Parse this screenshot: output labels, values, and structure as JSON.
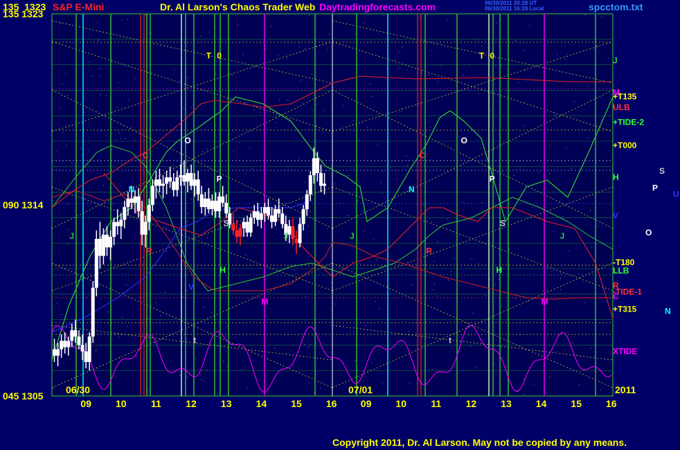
{
  "header": {
    "left_price_a": "135",
    "left_price_b": "1323",
    "symbol": "S&P E-Mini",
    "title": "Dr. Al Larson's Chaos Trader Web",
    "site": "Daytradingforecasts.com",
    "stamp1": "06/30/2011 20:28 UT",
    "stamp2": "06/30/2011 16:28 Local",
    "file": "spcctom.txt"
  },
  "footer": {
    "copyright": "Copyright 2011, Dr. Al Larson. May not be copied by any means."
  },
  "colors": {
    "background": "#000066",
    "grid_green": "#33cc33",
    "yellow": "#ffff00",
    "cyan": "#00ffff",
    "magenta": "#ff00ff",
    "red": "#cc0000",
    "white": "#ffffff",
    "blue": "#3333ff"
  },
  "chart_data": {
    "type": "line",
    "ylim": [
      1305,
      1323
    ],
    "y_ticks": [
      {
        "angle": "045",
        "price": "1305",
        "value": 1305
      },
      {
        "angle": "090",
        "price": "1314",
        "value": 1314
      },
      {
        "angle": "135",
        "price": "1323",
        "value": 1323
      }
    ],
    "x_ticks_day1": [
      "09",
      "10",
      "11",
      "12",
      "13",
      "14",
      "15",
      "16"
    ],
    "x_ticks_day2": [
      "09",
      "10",
      "11",
      "12",
      "13",
      "14",
      "15",
      "16"
    ],
    "date_day1": "06/30",
    "date_day2": "07/01",
    "year": "2011",
    "right_labels": [
      {
        "text": "J",
        "color": "#33cc33",
        "value": 1320.8
      },
      {
        "text": "M",
        "color": "#ff00ff",
        "value": 1319.3
      },
      {
        "text": "+T135",
        "color": "#ffff00",
        "value": 1319.1
      },
      {
        "text": "ULB",
        "color": "#ff3333",
        "value": 1318.6
      },
      {
        "text": "+TIDE-2",
        "color": "#33ff33",
        "value": 1317.9
      },
      {
        "text": "+T000",
        "color": "#ffff00",
        "value": 1316.8
      },
      {
        "text": "H",
        "color": "#33ff33",
        "value": 1315.3
      },
      {
        "text": "V",
        "color": "#3333ff",
        "value": 1313.5
      },
      {
        "text": "-T180",
        "color": "#ffff00",
        "value": 1311.3
      },
      {
        "text": "LLB",
        "color": "#33ff33",
        "value": 1310.9
      },
      {
        "text": "R",
        "color": "#ff3333",
        "value": 1310.2
      },
      {
        "text": "-TIDE-1",
        "color": "#ff3333",
        "value": 1309.9
      },
      {
        "text": "C",
        "color": "#ff00ff",
        "value": 1309.7
      },
      {
        "text": "+T315",
        "color": "#ffff00",
        "value": 1309.1
      },
      {
        "text": "XTIDE",
        "color": "#ff00ff",
        "value": 1307.1
      }
    ],
    "far_right_labels": [
      {
        "text": "S",
        "color": "#cccccc",
        "value": 1315.6
      },
      {
        "text": "P",
        "color": "#ffffff",
        "value": 1314.8
      },
      {
        "text": "U",
        "color": "#3333ff",
        "value": 1314.5
      },
      {
        "text": "O",
        "color": "#ffffff",
        "value": 1312.7
      },
      {
        "text": "N",
        "color": "#00ffff",
        "value": 1309.0
      }
    ],
    "planet_labels_day1": [
      {
        "text": "T",
        "color": "#ffff00",
        "x": 12.5,
        "value": 1320.9
      },
      {
        "text": "0",
        "color": "#ffff00",
        "x": 12.8,
        "value": 1320.9
      },
      {
        "text": "O",
        "color": "#ffffff",
        "x": 11.9,
        "value": 1316.9
      },
      {
        "text": "C",
        "color": "#ff3333",
        "x": 10.7,
        "value": 1316.2
      },
      {
        "text": "P",
        "color": "#ffffff",
        "x": 12.8,
        "value": 1315.1
      },
      {
        "text": "N",
        "color": "#00ffff",
        "x": 10.3,
        "value": 1314.6
      },
      {
        "text": "S",
        "color": "#cccccc",
        "x": 13.0,
        "value": 1313.0
      },
      {
        "text": "J",
        "color": "#33cc33",
        "x": 8.6,
        "value": 1312.4
      },
      {
        "text": "J",
        "color": "#33cc33",
        "x": 14.7,
        "value": 1312.4
      },
      {
        "text": "R",
        "color": "#ff3333",
        "x": 10.8,
        "value": 1311.7
      },
      {
        "text": "H",
        "color": "#33ff33",
        "x": 12.9,
        "value": 1310.8
      },
      {
        "text": "V",
        "color": "#3333ff",
        "x": 12.0,
        "value": 1310.0
      },
      {
        "text": "M",
        "color": "#ff00ff",
        "x": 14.1,
        "value": 1309.3
      },
      {
        "text": "t",
        "color": "#cccccc",
        "x": 12.1,
        "value": 1307.5
      }
    ],
    "planet_labels_day2": [
      {
        "text": "T",
        "color": "#ffff00",
        "x": 12.3,
        "value": 1320.9
      },
      {
        "text": "0",
        "color": "#ffff00",
        "x": 12.6,
        "value": 1320.9
      },
      {
        "text": "O",
        "color": "#ffffff",
        "x": 11.8,
        "value": 1316.9
      },
      {
        "text": "C",
        "color": "#ff3333",
        "x": 10.6,
        "value": 1316.2
      },
      {
        "text": "P",
        "color": "#ffffff",
        "x": 12.6,
        "value": 1315.1
      },
      {
        "text": "N",
        "color": "#00ffff",
        "x": 10.3,
        "value": 1314.6
      },
      {
        "text": "S",
        "color": "#cccccc",
        "x": 12.9,
        "value": 1313.0
      },
      {
        "text": "J",
        "color": "#33cc33",
        "x": 8.6,
        "value": 1312.4
      },
      {
        "text": "J",
        "color": "#33cc33",
        "x": 14.6,
        "value": 1312.4
      },
      {
        "text": "R",
        "color": "#ff3333",
        "x": 10.8,
        "value": 1311.7
      },
      {
        "text": "H",
        "color": "#33ff33",
        "x": 12.8,
        "value": 1310.8
      },
      {
        "text": "M",
        "color": "#ff00ff",
        "x": 14.1,
        "value": 1309.3
      },
      {
        "text": "t",
        "color": "#cccccc",
        "x": 11.4,
        "value": 1307.5
      }
    ],
    "price_bars": [
      {
        "x": 8.1,
        "o": 1307.2,
        "h": 1307.7,
        "l": 1306.6,
        "c": 1306.9
      },
      {
        "x": 8.2,
        "o": 1306.9,
        "h": 1307.5,
        "l": 1306.4,
        "c": 1307.2
      },
      {
        "x": 8.3,
        "o": 1307.2,
        "h": 1307.9,
        "l": 1306.8,
        "c": 1307.6
      },
      {
        "x": 8.4,
        "o": 1307.6,
        "h": 1308.0,
        "l": 1307.0,
        "c": 1307.3
      },
      {
        "x": 8.5,
        "o": 1307.3,
        "h": 1307.8,
        "l": 1306.9,
        "c": 1307.6
      },
      {
        "x": 8.6,
        "o": 1307.6,
        "h": 1308.4,
        "l": 1307.3,
        "c": 1308.1
      },
      {
        "x": 8.7,
        "o": 1308.1,
        "h": 1308.6,
        "l": 1307.5,
        "c": 1307.8
      },
      {
        "x": 8.8,
        "o": 1307.8,
        "h": 1308.1,
        "l": 1307.2,
        "c": 1307.4
      },
      {
        "x": 8.9,
        "o": 1307.4,
        "h": 1307.9,
        "l": 1306.7,
        "c": 1307.1
      },
      {
        "x": 9.0,
        "o": 1307.1,
        "h": 1307.5,
        "l": 1306.3,
        "c": 1306.6
      },
      {
        "x": 9.1,
        "o": 1306.6,
        "h": 1308.0,
        "l": 1306.2,
        "c": 1307.8
      },
      {
        "x": 9.2,
        "o": 1307.8,
        "h": 1310.4,
        "l": 1307.5,
        "c": 1310.1
      },
      {
        "x": 9.3,
        "o": 1310.1,
        "h": 1312.8,
        "l": 1309.7,
        "c": 1312.4
      },
      {
        "x": 9.4,
        "o": 1312.4,
        "h": 1313.2,
        "l": 1311.0,
        "c": 1311.6
      },
      {
        "x": 9.5,
        "o": 1311.6,
        "h": 1312.9,
        "l": 1311.2,
        "c": 1312.6
      },
      {
        "x": 9.6,
        "o": 1312.6,
        "h": 1313.0,
        "l": 1311.6,
        "c": 1312.0
      },
      {
        "x": 9.7,
        "o": 1312.0,
        "h": 1312.8,
        "l": 1311.4,
        "c": 1312.5
      },
      {
        "x": 9.8,
        "o": 1312.5,
        "h": 1313.4,
        "l": 1312.1,
        "c": 1313.2
      },
      {
        "x": 9.9,
        "o": 1313.2,
        "h": 1313.8,
        "l": 1312.6,
        "c": 1313.0
      },
      {
        "x": 10.0,
        "o": 1313.0,
        "h": 1313.6,
        "l": 1312.4,
        "c": 1313.3
      },
      {
        "x": 10.1,
        "o": 1313.3,
        "h": 1314.2,
        "l": 1312.9,
        "c": 1313.9
      },
      {
        "x": 10.2,
        "o": 1313.9,
        "h": 1314.6,
        "l": 1313.5,
        "c": 1314.3
      },
      {
        "x": 10.3,
        "o": 1314.3,
        "h": 1314.9,
        "l": 1313.8,
        "c": 1314.1
      },
      {
        "x": 10.4,
        "o": 1314.1,
        "h": 1314.7,
        "l": 1313.6,
        "c": 1314.4
      },
      {
        "x": 10.5,
        "o": 1314.4,
        "h": 1314.8,
        "l": 1313.4,
        "c": 1313.7
      },
      {
        "x": 10.6,
        "o": 1313.7,
        "h": 1314.2,
        "l": 1312.1,
        "c": 1312.6
      },
      {
        "x": 10.7,
        "o": 1312.6,
        "h": 1313.5,
        "l": 1312.0,
        "c": 1313.2
      },
      {
        "x": 10.8,
        "o": 1313.2,
        "h": 1314.3,
        "l": 1312.8,
        "c": 1314.0
      },
      {
        "x": 10.9,
        "o": 1314.0,
        "h": 1315.2,
        "l": 1313.7,
        "c": 1314.9
      },
      {
        "x": 11.0,
        "o": 1314.9,
        "h": 1315.6,
        "l": 1314.3,
        "c": 1315.2
      },
      {
        "x": 11.1,
        "o": 1315.2,
        "h": 1315.7,
        "l": 1314.6,
        "c": 1314.9
      },
      {
        "x": 11.2,
        "o": 1314.9,
        "h": 1315.4,
        "l": 1314.3,
        "c": 1315.0
      },
      {
        "x": 11.3,
        "o": 1315.0,
        "h": 1315.6,
        "l": 1314.5,
        "c": 1315.3
      },
      {
        "x": 11.4,
        "o": 1315.3,
        "h": 1315.8,
        "l": 1314.8,
        "c": 1315.1
      },
      {
        "x": 11.5,
        "o": 1315.1,
        "h": 1315.5,
        "l": 1314.4,
        "c": 1314.7
      },
      {
        "x": 11.6,
        "o": 1314.7,
        "h": 1315.6,
        "l": 1314.4,
        "c": 1315.3
      },
      {
        "x": 11.7,
        "o": 1315.3,
        "h": 1315.9,
        "l": 1314.9,
        "c": 1315.4
      },
      {
        "x": 11.8,
        "o": 1315.4,
        "h": 1316.1,
        "l": 1314.9,
        "c": 1315.1
      },
      {
        "x": 11.9,
        "o": 1315.1,
        "h": 1315.7,
        "l": 1314.6,
        "c": 1315.5
      },
      {
        "x": 12.0,
        "o": 1315.5,
        "h": 1315.9,
        "l": 1314.7,
        "c": 1314.9
      },
      {
        "x": 12.1,
        "o": 1314.9,
        "h": 1315.5,
        "l": 1314.4,
        "c": 1315.2
      },
      {
        "x": 12.2,
        "o": 1315.2,
        "h": 1315.6,
        "l": 1314.2,
        "c": 1314.5
      },
      {
        "x": 12.3,
        "o": 1314.5,
        "h": 1314.9,
        "l": 1313.6,
        "c": 1313.9
      },
      {
        "x": 12.4,
        "o": 1313.9,
        "h": 1314.6,
        "l": 1313.5,
        "c": 1314.3
      },
      {
        "x": 12.5,
        "o": 1314.3,
        "h": 1314.8,
        "l": 1313.6,
        "c": 1313.8
      },
      {
        "x": 12.6,
        "o": 1313.8,
        "h": 1314.5,
        "l": 1313.5,
        "c": 1314.2
      },
      {
        "x": 12.7,
        "o": 1314.2,
        "h": 1314.6,
        "l": 1313.4,
        "c": 1313.7
      },
      {
        "x": 12.8,
        "o": 1313.7,
        "h": 1314.6,
        "l": 1313.4,
        "c": 1314.4
      },
      {
        "x": 12.9,
        "o": 1314.4,
        "h": 1314.9,
        "l": 1313.9,
        "c": 1314.1
      },
      {
        "x": 13.0,
        "o": 1314.1,
        "h": 1314.5,
        "l": 1313.4,
        "c": 1313.6
      },
      {
        "x": 13.1,
        "o": 1313.6,
        "h": 1313.9,
        "l": 1312.9,
        "c": 1313.1
      },
      {
        "x": 13.2,
        "o": 1313.1,
        "h": 1313.6,
        "l": 1312.6,
        "c": 1312.8
      },
      {
        "x": 13.3,
        "o": 1312.8,
        "h": 1313.3,
        "l": 1312.2,
        "c": 1312.5
      },
      {
        "x": 13.4,
        "o": 1312.5,
        "h": 1313.1,
        "l": 1312.1,
        "c": 1312.9
      },
      {
        "x": 13.5,
        "o": 1312.9,
        "h": 1313.4,
        "l": 1312.5,
        "c": 1313.2
      },
      {
        "x": 13.6,
        "o": 1313.2,
        "h": 1313.5,
        "l": 1312.5,
        "c": 1312.7
      },
      {
        "x": 13.7,
        "o": 1312.7,
        "h": 1313.6,
        "l": 1312.5,
        "c": 1313.4
      },
      {
        "x": 13.8,
        "o": 1313.4,
        "h": 1314.0,
        "l": 1313.1,
        "c": 1313.7
      },
      {
        "x": 13.9,
        "o": 1313.7,
        "h": 1314.1,
        "l": 1313.0,
        "c": 1313.3
      },
      {
        "x": 14.0,
        "o": 1313.3,
        "h": 1313.9,
        "l": 1312.9,
        "c": 1313.6
      },
      {
        "x": 14.1,
        "o": 1313.6,
        "h": 1314.1,
        "l": 1313.2,
        "c": 1313.9
      },
      {
        "x": 14.2,
        "o": 1313.9,
        "h": 1314.3,
        "l": 1313.3,
        "c": 1313.5
      },
      {
        "x": 14.3,
        "o": 1313.5,
        "h": 1313.9,
        "l": 1312.9,
        "c": 1313.2
      },
      {
        "x": 14.4,
        "o": 1313.2,
        "h": 1314.0,
        "l": 1313.0,
        "c": 1313.8
      },
      {
        "x": 14.5,
        "o": 1313.8,
        "h": 1314.3,
        "l": 1313.4,
        "c": 1313.6
      },
      {
        "x": 14.6,
        "o": 1313.6,
        "h": 1313.9,
        "l": 1312.9,
        "c": 1313.1
      },
      {
        "x": 14.7,
        "o": 1313.1,
        "h": 1313.5,
        "l": 1312.3,
        "c": 1312.6
      },
      {
        "x": 14.8,
        "o": 1312.6,
        "h": 1313.3,
        "l": 1312.2,
        "c": 1313.0
      },
      {
        "x": 14.9,
        "o": 1313.0,
        "h": 1313.4,
        "l": 1312.1,
        "c": 1312.4
      },
      {
        "x": 15.0,
        "o": 1312.4,
        "h": 1312.8,
        "l": 1311.7,
        "c": 1312.2
      },
      {
        "x": 15.1,
        "o": 1312.2,
        "h": 1313.4,
        "l": 1312.0,
        "c": 1313.1
      },
      {
        "x": 15.2,
        "o": 1313.1,
        "h": 1314.0,
        "l": 1312.8,
        "c": 1313.8
      },
      {
        "x": 15.3,
        "o": 1313.8,
        "h": 1314.7,
        "l": 1313.5,
        "c": 1314.5
      },
      {
        "x": 15.4,
        "o": 1314.5,
        "h": 1315.6,
        "l": 1314.2,
        "c": 1315.4
      },
      {
        "x": 15.5,
        "o": 1315.4,
        "h": 1316.7,
        "l": 1315.0,
        "c": 1316.2
      },
      {
        "x": 15.6,
        "o": 1316.2,
        "h": 1316.5,
        "l": 1315.1,
        "c": 1315.5
      },
      {
        "x": 15.7,
        "o": 1315.5,
        "h": 1315.9,
        "l": 1314.6,
        "c": 1314.9
      },
      {
        "x": 15.8,
        "o": 1314.9,
        "h": 1315.5,
        "l": 1314.5,
        "c": 1315.0
      }
    ]
  }
}
